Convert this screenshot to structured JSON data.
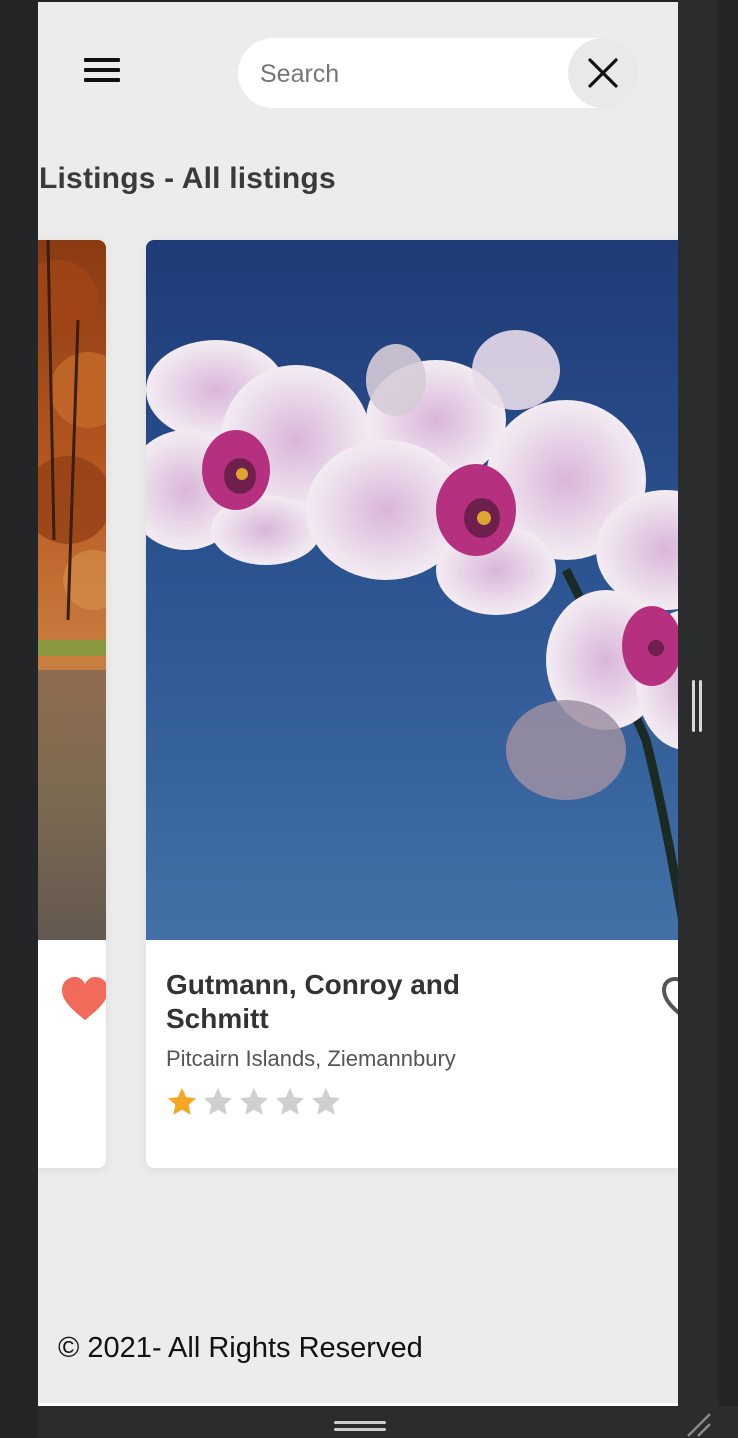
{
  "search": {
    "placeholder": "Search"
  },
  "page": {
    "title": "Listings - All listings"
  },
  "listings": [
    {
      "image": "autumn-trees-photo",
      "favorite": true,
      "heart_color": "#f26a5a"
    },
    {
      "image": "orchid-flowers-photo",
      "name": "Gutmann, Conroy and Schmitt",
      "location": "Pitcairn Islands, Ziemannbury",
      "rating": 1,
      "rating_max": 5,
      "favorite": false
    }
  ],
  "footer": {
    "copyright": "© 2021- All Rights Reserved"
  },
  "colors": {
    "background": "#ececec",
    "title": "#3a3a3a",
    "star_filled": "#f5a623",
    "star_empty": "#cfcfcf",
    "heart_favorite": "#f26a5a"
  }
}
